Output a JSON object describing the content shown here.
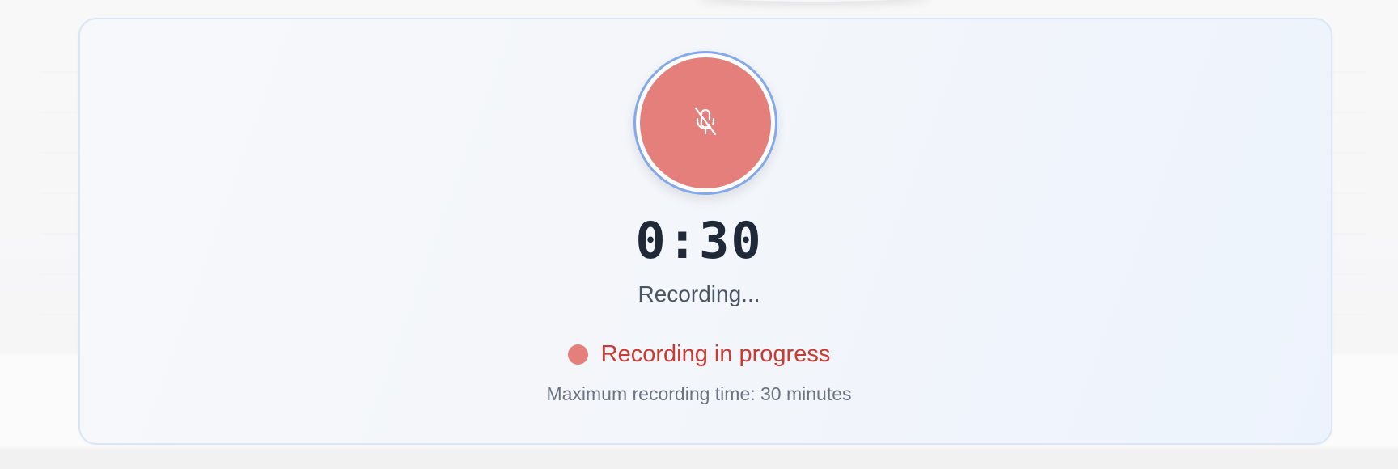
{
  "recorder": {
    "mic_button_icon": "microphone-off-icon",
    "timer": "0:30",
    "status_text": "Recording...",
    "progress_text": "Recording in progress",
    "max_time_text": "Maximum recording time: 30 minutes"
  },
  "colors": {
    "mic_fill": "#e47f7c",
    "mic_ring": "#84a8ea",
    "progress_text": "#c93a32",
    "timer_text": "#1f2937",
    "card_border": "#d9e6f7"
  }
}
